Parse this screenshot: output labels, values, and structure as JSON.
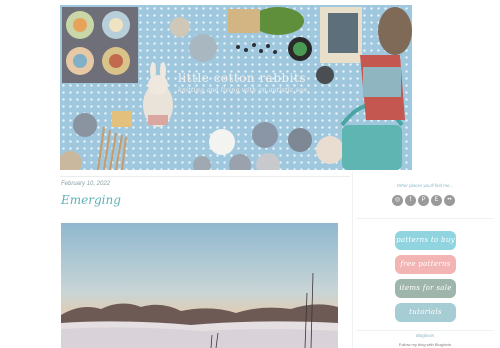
{
  "header": {
    "title": "little cotton rabbits",
    "tagline": "knitting and living with an autistic son"
  },
  "post": {
    "date": "February 10, 2022",
    "title": "Emerging"
  },
  "sidebar": {
    "social_heading": "Other places you'll find me...",
    "social_icons": [
      "instagram-icon",
      "facebook-icon",
      "pinterest-icon",
      "etsy-icon",
      "flickr-icon"
    ],
    "social_glyphs": [
      "◎",
      "f",
      "P",
      "E",
      "••"
    ],
    "buttons": [
      {
        "label": "patterns to buy",
        "color": "#8fd4df"
      },
      {
        "label": "free patterns",
        "color": "#f2b5b3"
      },
      {
        "label": "items for sale",
        "color": "#9eb5ac"
      },
      {
        "label": "tutorials",
        "color": "#a7cdd4"
      }
    ],
    "follow_heading": "Bloglovin",
    "follow_text": "Follow my blog with Bloglovin"
  }
}
